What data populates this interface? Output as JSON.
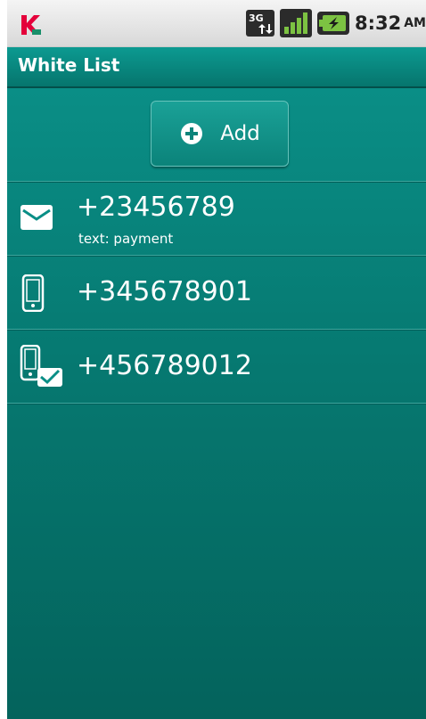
{
  "status_bar": {
    "app_icon": "kaspersky-logo",
    "network_icon": "3g-icon",
    "signal_icon": "signal-bars-icon",
    "battery_icon": "battery-charging-icon",
    "time": "8:32",
    "ampm": "AM"
  },
  "title_bar": {
    "title": "White List"
  },
  "add_button": {
    "label": "Add",
    "icon": "plus-circle-icon"
  },
  "list": {
    "items": [
      {
        "number": "+23456789",
        "subtitle": "text: payment",
        "icon": "envelope-icon"
      },
      {
        "number": "+345678901",
        "icon": "phone-icon"
      },
      {
        "number": "+456789012",
        "icon": "phone-with-sms-icon"
      }
    ]
  },
  "colors": {
    "title_bar": "#0c9a91",
    "background_top": "#0a8e86",
    "background_bottom": "#04635c",
    "status_bar": "#e6e6e6"
  }
}
